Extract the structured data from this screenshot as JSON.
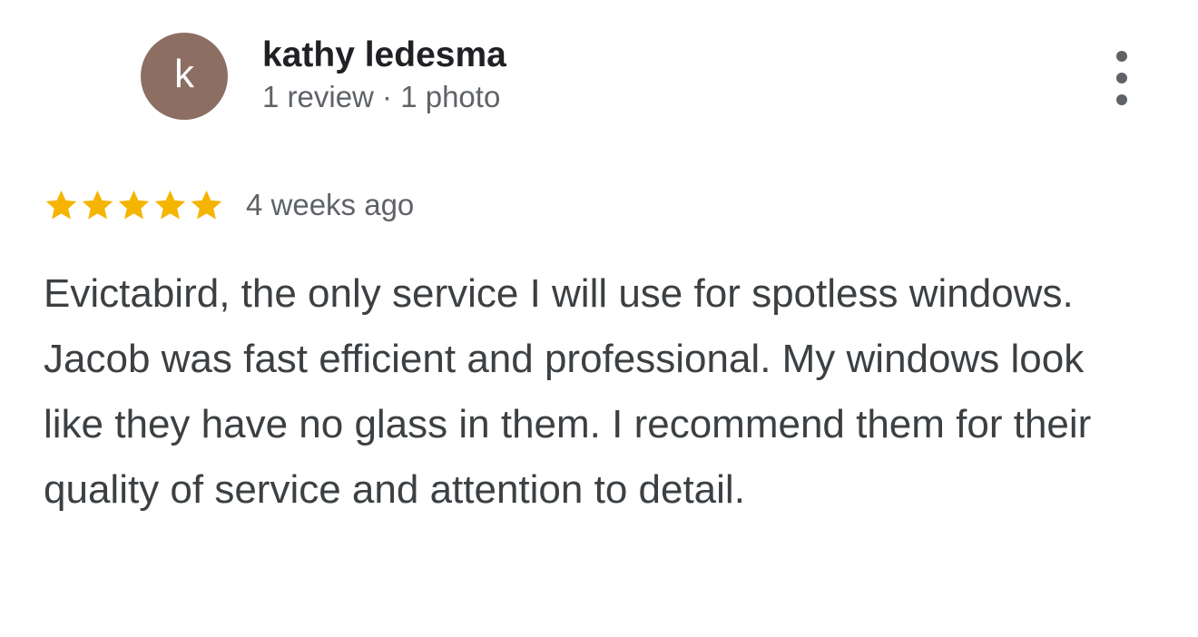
{
  "review": {
    "author": {
      "initial": "k",
      "name": "kathy ledesma",
      "meta": "1 review · 1 photo",
      "avatar_color": "#8d6e63"
    },
    "menu_icon": "more-vert-icon",
    "rating": {
      "value": 5,
      "max": 5,
      "star_color": "#f4b400",
      "star_icon": "star-icon"
    },
    "date": "4 weeks ago",
    "text": "Evictabird, the only service I will use for spotless windows. Jacob was fast efficient and professional. My windows look like they have no glass in them. I recommend them for their quality of service and attention to detail."
  }
}
